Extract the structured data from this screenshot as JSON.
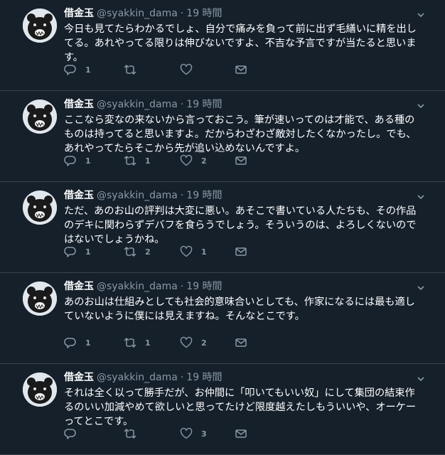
{
  "tweets": [
    {
      "name": "借金玉",
      "handle": "@syakkin_dama",
      "time": "19 時間",
      "text": "今日も見てたらわかるでしょ、自分で痛みを負って前に出ず毛繕いに精を出してる。あれやってる限りは伸びないですよ、不吉な予言ですが当たると思います。",
      "reply_count": "1",
      "retweet_count": "",
      "like_count": ""
    },
    {
      "name": "借金玉",
      "handle": "@syakkin_dama",
      "time": "19 時間",
      "text": "ここなら変なの来ないから言っておこう。筆が速いってのは才能で、ある種のものは持ってると思いますよ。だからわざわざ敵対したくなかったし。でも、あれやってたらそこから先が追い込めないんですよ。",
      "reply_count": "1",
      "retweet_count": "1",
      "like_count": "2"
    },
    {
      "name": "借金玉",
      "handle": "@syakkin_dama",
      "time": "19 時間",
      "text": "ただ、あのお山の評判は大変に悪い。あそこで書いている人たちも、その作品のデキに関わらずデバフを食らうでしょう。そういうのは、よろしくないのではないでしょうかね。",
      "reply_count": "1",
      "retweet_count": "2",
      "like_count": "1"
    },
    {
      "name": "借金玉",
      "handle": "@syakkin_dama",
      "time": "19 時間",
      "text": "あのお山は仕組みとしても社会的意味合いとしても、作家になるには最も適していないように僕には見えますね。そんなとこです。",
      "reply_count": "1",
      "retweet_count": "1",
      "like_count": "2"
    },
    {
      "name": "借金玉",
      "handle": "@syakkin_dama",
      "time": "19 時間",
      "text": "それは全く以って勝手だが、お仲間に「叩いてもいい奴」にして集団の結束作るのいい加減やめて欲しいと思ってたけど限度越えたしもういいや、オーケーってとこです。",
      "reply_count": "",
      "retweet_count": "",
      "like_count": "3"
    }
  ],
  "icons": {
    "avatar": "bear-avatar",
    "caret": "chevron-down-icon",
    "reply": "reply-icon",
    "retweet": "retweet-icon",
    "like": "heart-icon",
    "dm": "envelope-icon"
  },
  "colors": {
    "background": "#15202b",
    "secondary_text": "#8899a6",
    "divider": "#38444d"
  }
}
